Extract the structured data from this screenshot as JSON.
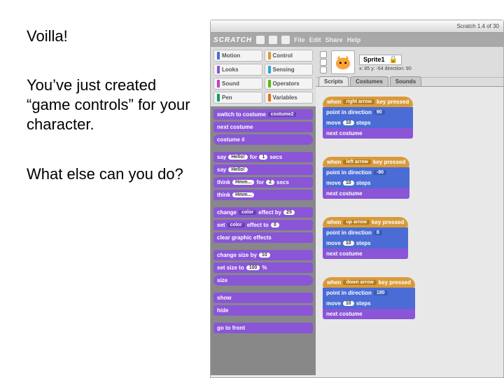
{
  "slide": {
    "text1": "Voilla!",
    "text2": "You’ve just created “game controls” for your character.",
    "text3": "What else can you do?"
  },
  "titlebar": "Scratch 1.4 of 30",
  "menu": {
    "logo": "SCRATCH",
    "file": "File",
    "edit": "Edit",
    "share": "Share",
    "help": "Help"
  },
  "cats": {
    "motion": "Motion",
    "control": "Control",
    "looks": "Looks",
    "sensing": "Sensing",
    "sound": "Sound",
    "operators": "Operators",
    "pen": "Pen",
    "variables": "Variables"
  },
  "colors": {
    "motion": "#4a6cd4",
    "control": "#d89a3a",
    "looks": "#8a55d7",
    "sensing": "#2ca5e2",
    "sound": "#bb42c3",
    "operators": "#5cb712",
    "pen": "#0e9a6c",
    "variables": "#e1711a"
  },
  "palette": {
    "switch": "switch to costume",
    "switch_v": "costume2",
    "next": "next costume",
    "costnum": "costume #",
    "say_for": "say",
    "hello": "Hello!",
    "for": "for",
    "secs1": "1",
    "secs_l": "secs",
    "say": "say",
    "hello2": "Hello!",
    "think_for": "think",
    "hmm": "Hmm...",
    "secs2": "2",
    "think": "think",
    "hmm2": "Hmm...",
    "change_eff": "change",
    "color": "color",
    "eff_l": "effect by",
    "eff_v": "25",
    "set_eff": "set",
    "eff_l2": "effect to",
    "eff_v2": "0",
    "clear": "clear graphic effects",
    "change_size": "change size by",
    "size_v": "10",
    "set_size": "set size to",
    "size_v2": "100",
    "pct": "%",
    "size": "size",
    "show": "show",
    "hide": "hide",
    "front": "go to front"
  },
  "sprite": {
    "name": "Sprite1",
    "xy": "x: 85   y: -64   direction: 90"
  },
  "tabs": {
    "scripts": "Scripts",
    "costumes": "Costumes",
    "sounds": "Sounds"
  },
  "scripts": {
    "s1": {
      "when": "when",
      "key": "right arrow",
      "pressed": "key pressed",
      "point": "point in direction",
      "dir": "90",
      "move": "move",
      "steps": "10",
      "steps_l": "steps",
      "next": "next costume"
    },
    "s2": {
      "key": "left arrow",
      "dir": "-90"
    },
    "s3": {
      "key": "up arrow",
      "dir": "0"
    },
    "s4": {
      "key": "down arrow",
      "dir": "180"
    }
  }
}
